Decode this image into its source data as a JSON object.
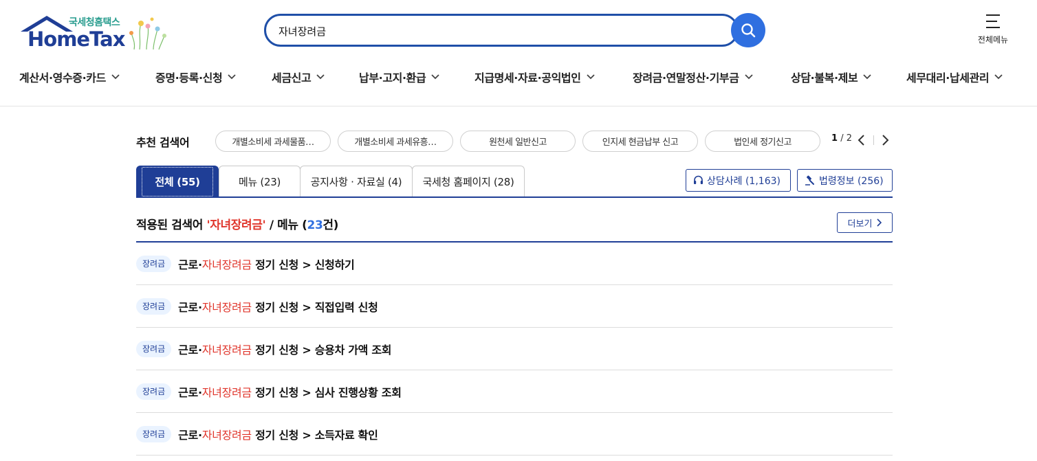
{
  "logo": {
    "subtitle": "국세청홈택스",
    "title": "HomeTax"
  },
  "search": {
    "value": "자녀장려금"
  },
  "header": {
    "all_menu_label": "전체메뉴"
  },
  "gnb": [
    "계산서·영수증·카드",
    "증명·등록·신청",
    "세금신고",
    "납부·고지·환급",
    "지급명세·자료·공익법인",
    "장려금·연말정산·기부금",
    "상담·불복·제보",
    "세무대리·납세관리"
  ],
  "recommended": {
    "label": "추천 검색어",
    "chips": [
      "개별소비세 과세물품…",
      "개별소비세 과세유흥…",
      "원천세 일반신고",
      "인지세 현금납부 신고",
      "법인세 정기신고"
    ],
    "page_current": "1",
    "page_total": "/ 2"
  },
  "tabs": [
    "전체 (55)",
    "메뉴 (23)",
    "공지사항 · 자료실 (4)",
    "국세청 홈페이지 (28)"
  ],
  "side_buttons": {
    "counsel": "상담사례 (1,163)",
    "law": "법령정보 (256)"
  },
  "result_header": {
    "prefix": "적용된 검색어 ",
    "keyword": "'자녀장려금'",
    "middle": " / 메뉴 (",
    "count": "23",
    "suffix": "건)",
    "more_label": "더보기"
  },
  "results": [
    {
      "badge": "장려금",
      "pre": "근로·",
      "hl": "자녀장려금",
      "post": " 정기 신청 > 신청하기"
    },
    {
      "badge": "장려금",
      "pre": "근로·",
      "hl": "자녀장려금",
      "post": " 정기 신청 > 직접입력 신청"
    },
    {
      "badge": "장려금",
      "pre": "근로·",
      "hl": "자녀장려금",
      "post": " 정기 신청 > 승용차 가액 조회"
    },
    {
      "badge": "장려금",
      "pre": "근로·",
      "hl": "자녀장려금",
      "post": " 정기 신청 > 심사 진행상황 조회"
    },
    {
      "badge": "장려금",
      "pre": "근로·",
      "hl": "자녀장려금",
      "post": " 정기 신청 > 소득자료 확인"
    }
  ],
  "colors": {
    "brand_navy": "#1f3e96",
    "search_blue": "#2f6fe0",
    "highlight_red": "#e0352b",
    "badge_bg": "#eaf3ff"
  }
}
